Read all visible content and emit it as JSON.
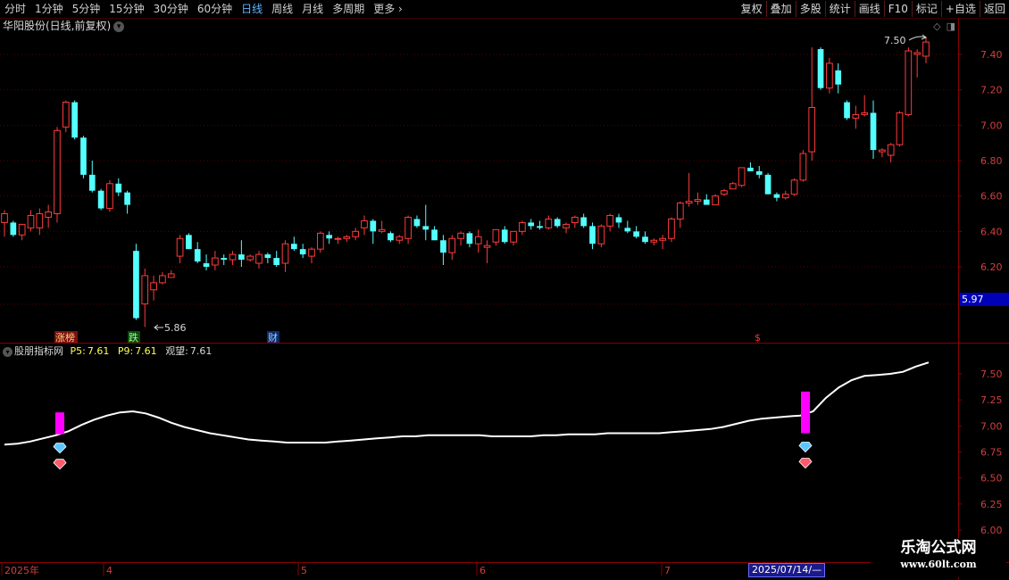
{
  "toolbar": {
    "periods": [
      "分时",
      "1分钟",
      "5分钟",
      "15分钟",
      "30分钟",
      "60分钟",
      "日线",
      "周线",
      "月线",
      "多周期",
      "更多 ›"
    ],
    "active_period": "日线",
    "buttons": [
      "复权",
      "叠加",
      "多股",
      "统计",
      "画线",
      "F10",
      "+自选",
      "返回"
    ],
    "extra": "标记"
  },
  "chart_title": "华阳股份(日线,前复权)",
  "main_axis": {
    "ticks": [
      "7.40",
      "7.20",
      "7.00",
      "6.80",
      "6.60",
      "6.40",
      "6.20"
    ],
    "current_price": "5.97"
  },
  "annotations": {
    "high_label": "7.50",
    "low_label": "5.86",
    "event_tags": [
      "涨榜",
      "跌",
      "财",
      "$"
    ]
  },
  "indicator": {
    "name": "股朋指标网",
    "p5_label": "P5:",
    "p5_value": "7.61",
    "p9_label": "P9:",
    "p9_value": "7.61",
    "view_label": "观望:",
    "view_value": "7.61",
    "axis_ticks": [
      "7.50",
      "7.25",
      "7.00",
      "6.75",
      "6.50",
      "6.25",
      "6.00"
    ]
  },
  "time_axis": {
    "labels": [
      "2025年",
      "4",
      "5",
      "6",
      "7"
    ],
    "cursor_date": "2025/07/14/—"
  },
  "watermark": {
    "line1": "乐淘公式网",
    "line2": "www.60lt.com"
  },
  "colors": {
    "up": "#ff3b3b",
    "down": "#54ffff",
    "line": "#ffffff",
    "signal": "#ff00ff",
    "axis": "#8a0000",
    "grid": "#5a0000"
  },
  "chart_data": {
    "type": "candlestick",
    "title": "华阳股份(日线,前复权)",
    "period_labels": [
      "2025年",
      "4",
      "5",
      "6",
      "7"
    ],
    "ylim": [
      6.0,
      7.5
    ],
    "ohlc": [
      [
        6.45,
        6.52,
        6.37,
        6.5
      ],
      [
        6.45,
        6.46,
        6.37,
        6.38
      ],
      [
        6.38,
        6.44,
        6.35,
        6.44
      ],
      [
        6.42,
        6.52,
        6.4,
        6.49
      ],
      [
        6.42,
        6.53,
        6.38,
        6.5
      ],
      [
        6.48,
        6.55,
        6.42,
        6.51
      ],
      [
        6.5,
        6.99,
        6.45,
        6.97
      ],
      [
        6.99,
        7.14,
        6.96,
        7.13
      ],
      [
        7.13,
        7.14,
        6.92,
        6.93
      ],
      [
        6.93,
        6.94,
        6.7,
        6.72
      ],
      [
        6.72,
        6.8,
        6.62,
        6.63
      ],
      [
        6.63,
        6.64,
        6.52,
        6.53
      ],
      [
        6.53,
        6.69,
        6.51,
        6.67
      ],
      [
        6.67,
        6.7,
        6.6,
        6.62
      ],
      [
        6.62,
        6.63,
        6.5,
        6.55
      ],
      [
        6.29,
        6.33,
        5.9,
        5.91
      ],
      [
        5.99,
        6.19,
        5.86,
        6.15
      ],
      [
        6.07,
        6.15,
        6.01,
        6.11
      ],
      [
        6.11,
        6.17,
        6.1,
        6.15
      ],
      [
        6.14,
        6.18,
        6.15,
        6.16
      ],
      [
        6.26,
        6.38,
        6.22,
        6.36
      ],
      [
        6.38,
        6.39,
        6.3,
        6.3
      ],
      [
        6.3,
        6.34,
        6.22,
        6.23
      ],
      [
        6.22,
        6.27,
        6.18,
        6.2
      ],
      [
        6.21,
        6.29,
        6.18,
        6.25
      ],
      [
        6.25,
        6.27,
        6.21,
        6.24
      ],
      [
        6.24,
        6.29,
        6.21,
        6.27
      ],
      [
        6.27,
        6.35,
        6.2,
        6.24
      ],
      [
        6.24,
        6.27,
        6.23,
        6.26
      ],
      [
        6.22,
        6.29,
        6.19,
        6.27
      ],
      [
        6.27,
        6.28,
        6.22,
        6.25
      ],
      [
        6.25,
        6.29,
        6.2,
        6.21
      ],
      [
        6.22,
        6.35,
        6.17,
        6.33
      ],
      [
        6.33,
        6.37,
        6.29,
        6.3
      ],
      [
        6.3,
        6.33,
        6.25,
        6.27
      ],
      [
        6.26,
        6.31,
        6.22,
        6.3
      ],
      [
        6.3,
        6.4,
        6.28,
        6.39
      ],
      [
        6.38,
        6.4,
        6.33,
        6.36
      ],
      [
        6.36,
        6.37,
        6.33,
        6.36
      ],
      [
        6.36,
        6.38,
        6.34,
        6.37
      ],
      [
        6.37,
        6.42,
        6.35,
        6.4
      ],
      [
        6.42,
        6.49,
        6.38,
        6.46
      ],
      [
        6.46,
        6.47,
        6.33,
        6.4
      ],
      [
        6.4,
        6.46,
        6.39,
        6.41
      ],
      [
        6.39,
        6.4,
        6.34,
        6.35
      ],
      [
        6.35,
        6.38,
        6.33,
        6.37
      ],
      [
        6.36,
        6.49,
        6.33,
        6.48
      ],
      [
        6.47,
        6.49,
        6.42,
        6.43
      ],
      [
        6.43,
        6.55,
        6.35,
        6.41
      ],
      [
        6.41,
        6.43,
        6.35,
        6.35
      ],
      [
        6.35,
        6.38,
        6.21,
        6.28
      ],
      [
        6.28,
        6.38,
        6.24,
        6.36
      ],
      [
        6.36,
        6.4,
        6.32,
        6.39
      ],
      [
        6.39,
        6.4,
        6.31,
        6.33
      ],
      [
        6.33,
        6.41,
        6.28,
        6.37
      ],
      [
        6.31,
        6.35,
        6.22,
        6.32
      ],
      [
        6.34,
        6.41,
        6.32,
        6.41
      ],
      [
        6.41,
        6.43,
        6.33,
        6.34
      ],
      [
        6.34,
        6.4,
        6.32,
        6.4
      ],
      [
        6.4,
        6.46,
        6.38,
        6.45
      ],
      [
        6.45,
        6.47,
        6.41,
        6.43
      ],
      [
        6.43,
        6.46,
        6.41,
        6.42
      ],
      [
        6.42,
        6.49,
        6.41,
        6.47
      ],
      [
        6.47,
        6.48,
        6.42,
        6.43
      ],
      [
        6.42,
        6.45,
        6.39,
        6.44
      ],
      [
        6.45,
        6.49,
        6.42,
        6.48
      ],
      [
        6.48,
        6.5,
        6.42,
        6.43
      ],
      [
        6.43,
        6.45,
        6.3,
        6.33
      ],
      [
        6.33,
        6.44,
        6.31,
        6.43
      ],
      [
        6.43,
        6.5,
        6.4,
        6.49
      ],
      [
        6.48,
        6.5,
        6.42,
        6.45
      ],
      [
        6.42,
        6.46,
        6.39,
        6.4
      ],
      [
        6.4,
        6.43,
        6.36,
        6.37
      ],
      [
        6.37,
        6.4,
        6.33,
        6.34
      ],
      [
        6.34,
        6.36,
        6.32,
        6.35
      ],
      [
        6.35,
        6.38,
        6.3,
        6.36
      ],
      [
        6.36,
        6.48,
        6.34,
        6.47
      ],
      [
        6.47,
        6.57,
        6.42,
        6.56
      ],
      [
        6.56,
        6.73,
        6.54,
        6.57
      ],
      [
        6.57,
        6.62,
        6.55,
        6.58
      ],
      [
        6.58,
        6.61,
        6.56,
        6.55
      ],
      [
        6.55,
        6.61,
        6.55,
        6.6
      ],
      [
        6.61,
        6.64,
        6.6,
        6.63
      ],
      [
        6.64,
        6.68,
        6.64,
        6.67
      ],
      [
        6.66,
        6.76,
        6.65,
        6.76
      ],
      [
        6.76,
        6.79,
        6.75,
        6.74
      ],
      [
        6.74,
        6.77,
        6.7,
        6.72
      ],
      [
        6.72,
        6.73,
        6.61,
        6.61
      ],
      [
        6.61,
        6.62,
        6.57,
        6.59
      ],
      [
        6.59,
        6.63,
        6.58,
        6.61
      ],
      [
        6.61,
        6.7,
        6.6,
        6.69
      ],
      [
        6.69,
        6.86,
        6.68,
        6.84
      ],
      [
        6.85,
        7.44,
        6.8,
        7.1
      ],
      [
        7.43,
        7.44,
        7.2,
        7.21
      ],
      [
        7.21,
        7.38,
        7.18,
        7.35
      ],
      [
        7.31,
        7.35,
        7.18,
        7.23
      ],
      [
        7.13,
        7.14,
        7.03,
        7.04
      ],
      [
        7.04,
        7.11,
        6.98,
        7.06
      ],
      [
        7.06,
        7.17,
        7.05,
        7.07
      ],
      [
        7.07,
        7.14,
        6.81,
        6.86
      ],
      [
        6.85,
        6.87,
        6.82,
        6.86
      ],
      [
        6.83,
        6.9,
        6.79,
        6.89
      ],
      [
        6.89,
        7.08,
        6.88,
        7.07
      ],
      [
        7.06,
        7.44,
        7.05,
        7.42
      ],
      [
        7.4,
        7.43,
        7.27,
        7.41
      ],
      [
        7.39,
        7.5,
        7.35,
        7.47
      ]
    ],
    "indicator_line": [
      6.82,
      6.83,
      6.85,
      6.88,
      6.91,
      6.95,
      7.01,
      7.06,
      7.1,
      7.13,
      7.14,
      7.12,
      7.08,
      7.03,
      6.99,
      6.96,
      6.93,
      6.91,
      6.89,
      6.87,
      6.86,
      6.85,
      6.84,
      6.84,
      6.84,
      6.84,
      6.85,
      6.86,
      6.87,
      6.88,
      6.89,
      6.9,
      6.9,
      6.91,
      6.91,
      6.91,
      6.91,
      6.91,
      6.9,
      6.9,
      6.9,
      6.9,
      6.91,
      6.91,
      6.92,
      6.92,
      6.92,
      6.93,
      6.93,
      6.93,
      6.93,
      6.93,
      6.94,
      6.95,
      6.96,
      6.97,
      6.99,
      7.02,
      7.05,
      7.07,
      7.08,
      7.09,
      7.1,
      7.14,
      7.27,
      7.37,
      7.44,
      7.48,
      7.49,
      7.5,
      7.52,
      7.57,
      7.61
    ],
    "signals": [
      {
        "position": "early",
        "top": 7.13,
        "bottom": 6.92
      },
      {
        "position": "late",
        "top": 7.33,
        "bottom": 6.93
      }
    ]
  }
}
